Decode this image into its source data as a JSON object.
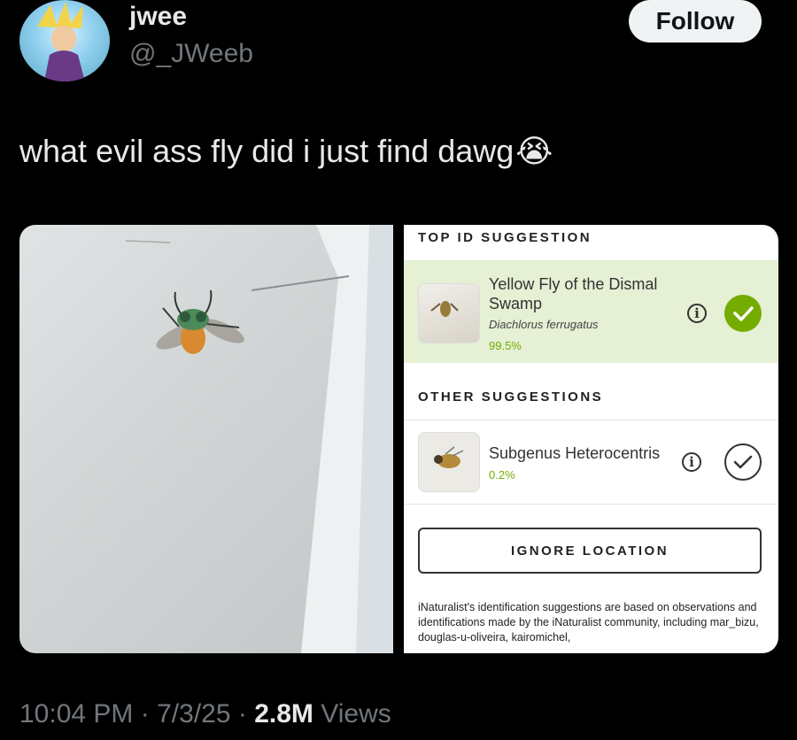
{
  "author": {
    "display_name": "jwee",
    "handle": "@_JWeeb",
    "follow_label": "Follow"
  },
  "tweet": {
    "text": "what evil ass fly did i just find dawg",
    "emoji": "😭"
  },
  "inaturalist": {
    "top_heading": "TOP ID SUGGESTION",
    "top": {
      "name": "Yellow Fly of the Dismal Swamp",
      "scientific": "Diachlorus ferrugatus",
      "score": "99.5%"
    },
    "other_heading": "OTHER SUGGESTIONS",
    "other": [
      {
        "name": "Subgenus Heterocentris",
        "score": "0.2%"
      }
    ],
    "ignore_label": "IGNORE LOCATION",
    "disclaimer": "iNaturalist's identification suggestions are based on observations and identifications made by the iNaturalist community, including mar_bizu, douglas-u-oliveira, kairomichel,",
    "info_glyph": "i",
    "accent_color": "#74ac00",
    "highlight_color": "#e5f0d4"
  },
  "meta": {
    "time": "10:04 PM",
    "date": "7/3/25",
    "separator": "·",
    "views_count": "2.8M",
    "views_label": "Views"
  }
}
